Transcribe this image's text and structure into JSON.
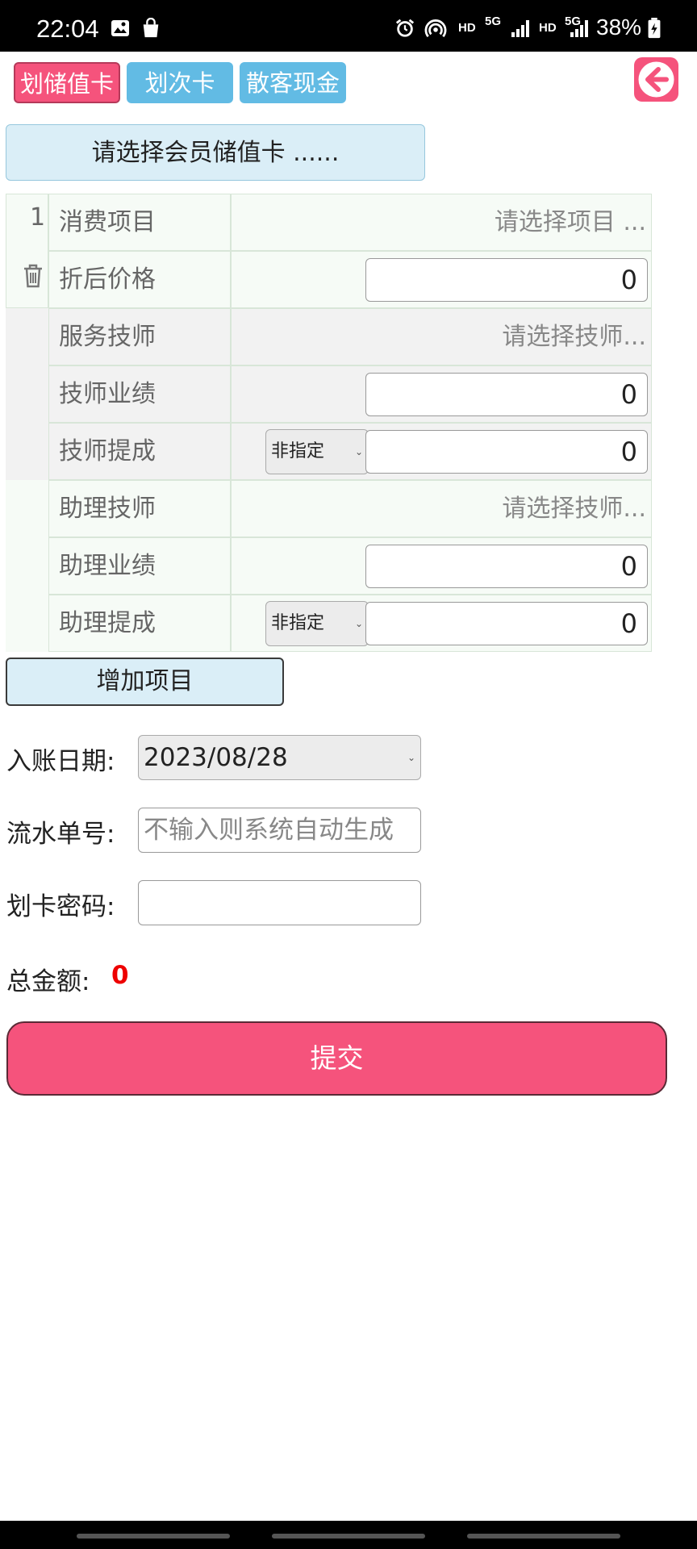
{
  "status_bar": {
    "time": "22:04",
    "hd1": "HD",
    "net1": "5G",
    "hd2": "HD",
    "net2": "5G",
    "battery": "38%"
  },
  "tabs": [
    {
      "label": "划储值卡",
      "active": true
    },
    {
      "label": "划次卡",
      "active": false
    },
    {
      "label": "散客现金",
      "active": false
    }
  ],
  "member_select": {
    "label": "请选择会员储值卡 ......"
  },
  "item": {
    "index": "1",
    "rows": {
      "consume_label": "消费项目",
      "consume_placeholder": "请选择项目 ...",
      "price_label": "折后价格",
      "price_value": "0",
      "tech_label": "服务技师",
      "tech_placeholder": "请选择技师...",
      "tech_perf_label": "技师业绩",
      "tech_perf_value": "0",
      "tech_comm_label": "技师提成",
      "tech_comm_select": "非指定",
      "tech_comm_value": "0",
      "asst_label": "助理技师",
      "asst_placeholder": "请选择技师...",
      "asst_perf_label": "助理业绩",
      "asst_perf_value": "0",
      "asst_comm_label": "助理提成",
      "asst_comm_select": "非指定",
      "asst_comm_value": "0"
    }
  },
  "add_item_label": "增加项目",
  "form": {
    "date_label": "入账日期:",
    "date_value": "2023/08/28",
    "serial_label": "流水单号:",
    "serial_placeholder": "不输入则系统自动生成",
    "password_label": "划卡密码:",
    "password_value": "",
    "total_label": "总金额:",
    "total_value": "0"
  },
  "submit_label": "提交",
  "colors": {
    "accent_pink": "#f5537c",
    "tab_blue": "#62bbe4",
    "total_red": "#e00000"
  }
}
